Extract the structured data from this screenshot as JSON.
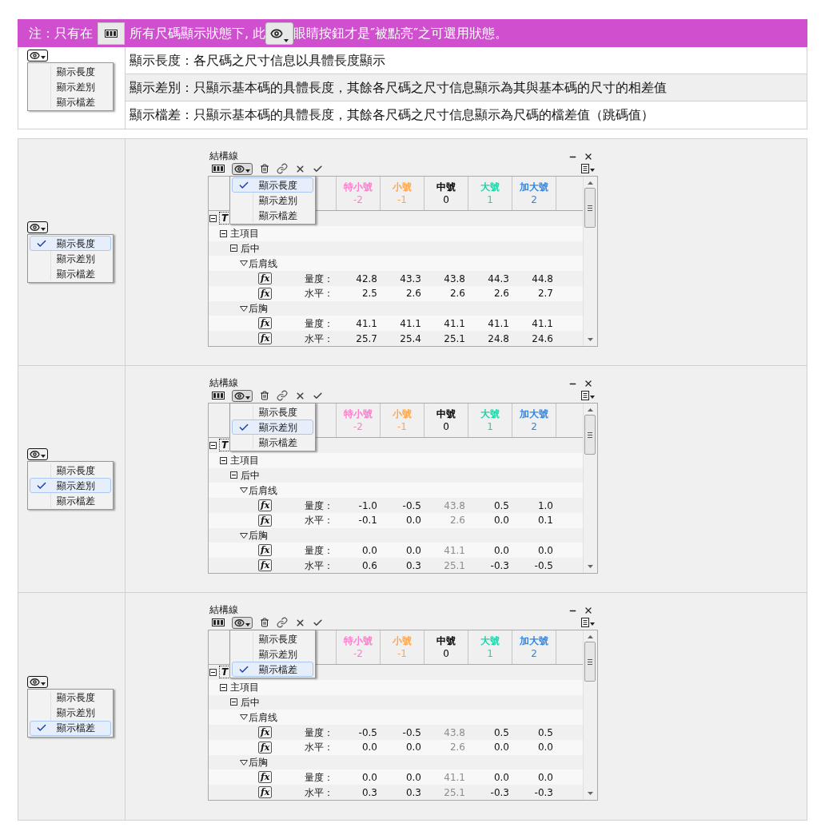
{
  "banner": {
    "parts": [
      {
        "kind": "text",
        "text": "注：只有在"
      },
      {
        "kind": "grid-button"
      },
      {
        "kind": "text",
        "text": "所有尺碼顯示狀態下, 此"
      },
      {
        "kind": "eye-button"
      },
      {
        "kind": "text",
        "text": "眼睛按鈕才是″被點亮″之可選用狀態。"
      }
    ]
  },
  "legend": {
    "menu": [
      {
        "label": "顯示長度",
        "selected": false
      },
      {
        "label": "顯示差別",
        "selected": false
      },
      {
        "label": "顯示檔差",
        "selected": false
      }
    ],
    "descriptions": [
      "顯示長度：各尺碼之尺寸信息以具體長度顯示",
      "顯示差別：只顯示基本碼的具體長度，其餘各尺碼之尺寸信息顯示為其與基本碼的尺寸的相差值",
      "顯示檔差：只顯示基本碼的具體長度，其餘各尺碼之尺寸信息顯示為尺碼的檔差值（跳碼值）"
    ]
  },
  "panels": [
    {
      "left_menu": [
        {
          "label": "顯示長度",
          "selected": true
        },
        {
          "label": "顯示差別",
          "selected": false
        },
        {
          "label": "顯示檔差",
          "selected": false
        }
      ],
      "widget": {
        "title": "結構線",
        "menu": [
          {
            "label": "顯示長度",
            "selected": true
          },
          {
            "label": "顯示差別",
            "selected": false
          },
          {
            "label": "顯示檔差",
            "selected": false
          }
        ],
        "columns": [
          {
            "name": "特小號",
            "number": "-2",
            "color": "#ff7ccf",
            "dimmed": false
          },
          {
            "name": "小號",
            "number": "-1",
            "color": "#ffa64d",
            "dimmed": false
          },
          {
            "name": "中號",
            "number": "0",
            "color": "#000000",
            "dimmed": false
          },
          {
            "name": "大號",
            "number": "1",
            "color": "#1ed3a8",
            "dimmed": false
          },
          {
            "name": "加大號",
            "number": "2",
            "color": "#2f86e8",
            "dimmed": false
          }
        ],
        "tree": [
          {
            "kind": "root",
            "label": "T",
            "children": [
              {
                "kind": "node",
                "label": "主項目",
                "children": [
                  {
                    "kind": "node",
                    "label": "后中",
                    "children": [
                      {
                        "kind": "group",
                        "label": "后肩线",
                        "children": [
                          {
                            "kind": "measure",
                            "button": "fx",
                            "label": "量度：",
                            "values": [
                              "42.8",
                              "43.3",
                              "43.8",
                              "44.3",
                              "44.8"
                            ]
                          },
                          {
                            "kind": "measure",
                            "button": "fx",
                            "label": "水平：",
                            "values": [
                              "2.5",
                              "2.6",
                              "2.6",
                              "2.6",
                              "2.7"
                            ]
                          }
                        ]
                      },
                      {
                        "kind": "group",
                        "label": "后胸",
                        "children": [
                          {
                            "kind": "measure",
                            "button": "fx",
                            "label": "量度：",
                            "values": [
                              "41.1",
                              "41.1",
                              "41.1",
                              "41.1",
                              "41.1"
                            ]
                          },
                          {
                            "kind": "measure",
                            "button": "fx",
                            "label": "水平：",
                            "values": [
                              "25.7",
                              "25.4",
                              "25.1",
                              "24.8",
                              "24.6"
                            ]
                          }
                        ]
                      }
                    ]
                  }
                ]
              }
            ]
          }
        ]
      }
    },
    {
      "left_menu": [
        {
          "label": "顯示長度",
          "selected": false
        },
        {
          "label": "顯示差別",
          "selected": true
        },
        {
          "label": "顯示檔差",
          "selected": false
        }
      ],
      "widget": {
        "title": "結構線",
        "menu": [
          {
            "label": "顯示長度",
            "selected": false
          },
          {
            "label": "顯示差別",
            "selected": true
          },
          {
            "label": "顯示檔差",
            "selected": false
          }
        ],
        "columns": [
          {
            "name": "特小號",
            "number": "-2",
            "color": "#ff7ccf",
            "dimmed": false
          },
          {
            "name": "小號",
            "number": "-1",
            "color": "#ffa64d",
            "dimmed": false
          },
          {
            "name": "中號",
            "number": "0",
            "color": "#000000",
            "dimmed": true
          },
          {
            "name": "大號",
            "number": "1",
            "color": "#1ed3a8",
            "dimmed": false
          },
          {
            "name": "加大號",
            "number": "2",
            "color": "#2f86e8",
            "dimmed": false
          }
        ],
        "tree": [
          {
            "kind": "root",
            "label": "T",
            "children": [
              {
                "kind": "node",
                "label": "主項目",
                "children": [
                  {
                    "kind": "node",
                    "label": "后中",
                    "children": [
                      {
                        "kind": "group",
                        "label": "后肩线",
                        "children": [
                          {
                            "kind": "measure",
                            "button": "fx",
                            "label": "量度：",
                            "values": [
                              "-1.0",
                              "-0.5",
                              "43.8",
                              "0.5",
                              "1.0"
                            ]
                          },
                          {
                            "kind": "measure",
                            "button": "fx",
                            "label": "水平：",
                            "values": [
                              "-0.1",
                              "0.0",
                              "2.6",
                              "0.0",
                              "0.1"
                            ]
                          }
                        ]
                      },
                      {
                        "kind": "group",
                        "label": "后胸",
                        "children": [
                          {
                            "kind": "measure",
                            "button": "fx",
                            "label": "量度：",
                            "values": [
                              "0.0",
                              "0.0",
                              "41.1",
                              "0.0",
                              "0.0"
                            ]
                          },
                          {
                            "kind": "measure",
                            "button": "fx",
                            "label": "水平：",
                            "values": [
                              "0.6",
                              "0.3",
                              "25.1",
                              "-0.3",
                              "-0.5"
                            ]
                          }
                        ]
                      }
                    ]
                  }
                ]
              }
            ]
          }
        ]
      }
    },
    {
      "left_menu": [
        {
          "label": "顯示長度",
          "selected": false
        },
        {
          "label": "顯示差別",
          "selected": false
        },
        {
          "label": "顯示檔差",
          "selected": true
        }
      ],
      "widget": {
        "title": "結構線",
        "menu": [
          {
            "label": "顯示長度",
            "selected": false
          },
          {
            "label": "顯示差別",
            "selected": false
          },
          {
            "label": "顯示檔差",
            "selected": true
          }
        ],
        "columns": [
          {
            "name": "特小號",
            "number": "-2",
            "color": "#ff7ccf",
            "dimmed": false
          },
          {
            "name": "小號",
            "number": "-1",
            "color": "#ffa64d",
            "dimmed": false
          },
          {
            "name": "中號",
            "number": "0",
            "color": "#000000",
            "dimmed": true
          },
          {
            "name": "大號",
            "number": "1",
            "color": "#1ed3a8",
            "dimmed": false
          },
          {
            "name": "加大號",
            "number": "2",
            "color": "#2f86e8",
            "dimmed": false
          }
        ],
        "tree": [
          {
            "kind": "root",
            "label": "T",
            "children": [
              {
                "kind": "node",
                "label": "主項目",
                "children": [
                  {
                    "kind": "node",
                    "label": "后中",
                    "children": [
                      {
                        "kind": "group",
                        "label": "后肩线",
                        "children": [
                          {
                            "kind": "measure",
                            "button": "fx",
                            "label": "量度：",
                            "values": [
                              "-0.5",
                              "-0.5",
                              "43.8",
                              "0.5",
                              "0.5"
                            ]
                          },
                          {
                            "kind": "measure",
                            "button": "fx",
                            "label": "水平：",
                            "values": [
                              "0.0",
                              "0.0",
                              "2.6",
                              "0.0",
                              "0.0"
                            ]
                          }
                        ]
                      },
                      {
                        "kind": "group",
                        "label": "后胸",
                        "children": [
                          {
                            "kind": "measure",
                            "button": "fx",
                            "label": "量度：",
                            "values": [
                              "0.0",
                              "0.0",
                              "41.1",
                              "0.0",
                              "0.0"
                            ]
                          },
                          {
                            "kind": "measure",
                            "button": "fx",
                            "label": "水平：",
                            "values": [
                              "0.3",
                              "0.3",
                              "25.1",
                              "-0.3",
                              "-0.3"
                            ]
                          }
                        ]
                      }
                    ]
                  }
                ]
              }
            ]
          }
        ]
      }
    }
  ]
}
